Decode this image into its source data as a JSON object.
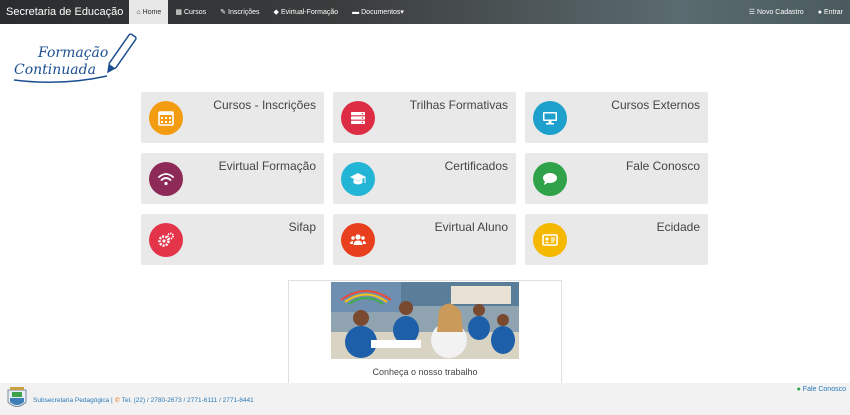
{
  "navbar": {
    "brand": "Secretaria de Educação",
    "items": [
      {
        "icon": "home-icon",
        "glyph": "⌂",
        "label": "Home",
        "active": true
      },
      {
        "icon": "calendar-icon",
        "glyph": "▦",
        "label": "Cursos"
      },
      {
        "icon": "pencil-icon",
        "glyph": "✎",
        "label": "Inscrições"
      },
      {
        "icon": "diamond-icon",
        "glyph": "◆",
        "label": "Evirtual-Formação"
      },
      {
        "icon": "folder-icon",
        "glyph": "▬",
        "label": "Documentos▾"
      }
    ],
    "right": [
      {
        "icon": "list-icon",
        "glyph": "☰",
        "label": "Novo Cadastro"
      },
      {
        "icon": "user-icon",
        "glyph": "●",
        "label": "Entrar"
      }
    ]
  },
  "logo": {
    "line1": "Formação",
    "line2": "Continuada"
  },
  "cards": [
    {
      "label": "Cursos - Inscrições",
      "icon": "calendar-icon",
      "color": "#f39c12"
    },
    {
      "label": "Trilhas Formativas",
      "icon": "server-icon",
      "color": "#dc2d44"
    },
    {
      "label": "Cursos Externos",
      "icon": "monitor-icon",
      "color": "#1ea0cd"
    },
    {
      "label": "Evirtual Formação",
      "icon": "wifi-icon",
      "color": "#8e2a58"
    },
    {
      "label": "Certificados",
      "icon": "graduation-cap-icon",
      "color": "#22b5d6"
    },
    {
      "label": "Fale Conosco",
      "icon": "chat-icon",
      "color": "#2fa24a"
    },
    {
      "label": "Sifap",
      "icon": "gears-icon",
      "color": "#e3344a"
    },
    {
      "label": "Evirtual Aluno",
      "icon": "users-icon",
      "color": "#e8401f"
    },
    {
      "label": "Ecidade",
      "icon": "id-card-icon",
      "color": "#f5b800"
    }
  ],
  "promo": {
    "caption": "Conheça o nosso trabalho"
  },
  "footer": {
    "org": "Subsecretaria Pedagógica |",
    "phone": "Tel. (22) / 2780-2673 / 2771-6111 / 2771-8441",
    "contact": "Fale Conosco"
  }
}
